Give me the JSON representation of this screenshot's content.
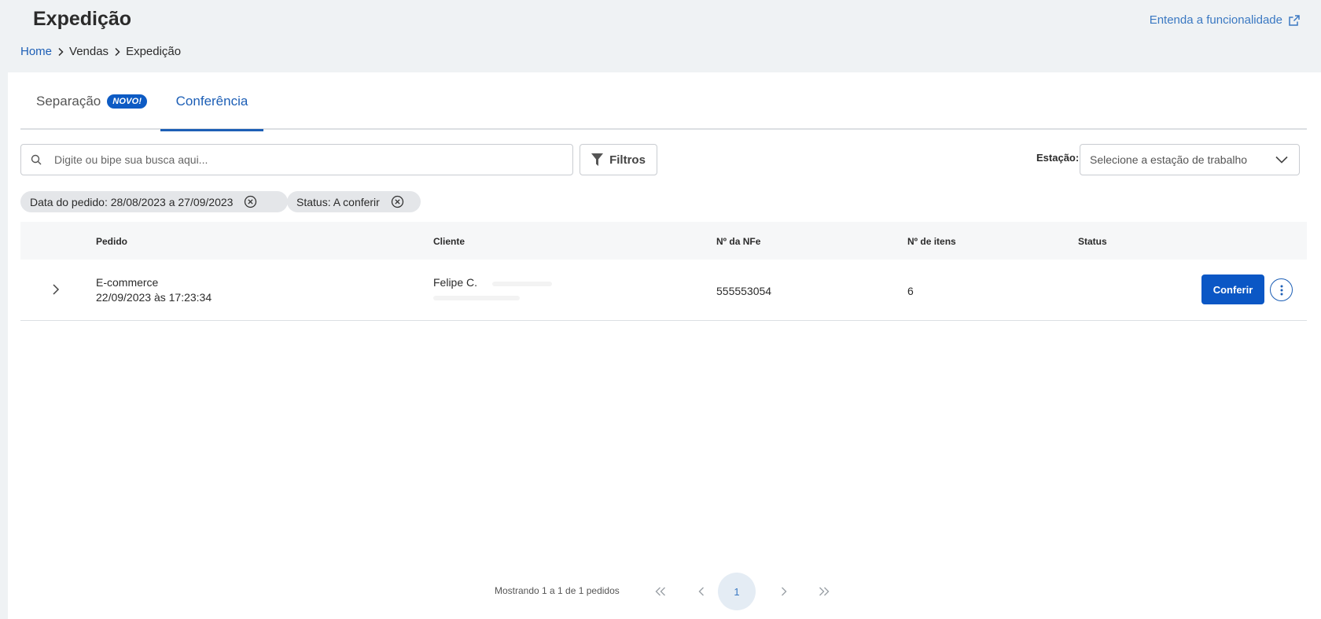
{
  "header": {
    "title": "Expedição",
    "help_link": "Entenda a funcionalidade",
    "breadcrumb": [
      "Home",
      "Vendas",
      "Expedição"
    ]
  },
  "tabs": [
    {
      "label": "Separação",
      "badge": "NOVO!",
      "active": false
    },
    {
      "label": "Conferência",
      "active": true
    }
  ],
  "search": {
    "placeholder": "Digite ou bipe sua busca aqui...",
    "value": ""
  },
  "filter_button": "Filtros",
  "station": {
    "label": "Estação:",
    "placeholder": "Selecione a estação de trabalho"
  },
  "chips": [
    "Data do pedido: 28/08/2023 a 27/09/2023",
    "Status: A conferir"
  ],
  "table": {
    "columns": [
      "Pedido",
      "Cliente",
      "Nº da NFe",
      "Nº de itens",
      "Status"
    ],
    "rows": [
      {
        "order_type": "E-commerce",
        "order_date": "22/09/2023 às 17:23:34",
        "client": "Felipe C.",
        "nfe": "555553054",
        "items": "6",
        "status": "",
        "action": "Conferir"
      }
    ]
  },
  "pagination": {
    "summary": "Mostrando 1 a 1 de 1 pedidos",
    "current_page": "1"
  },
  "colors": {
    "primary": "#0b57c5",
    "link": "#1d5fb6",
    "background": "#eff2f4"
  }
}
